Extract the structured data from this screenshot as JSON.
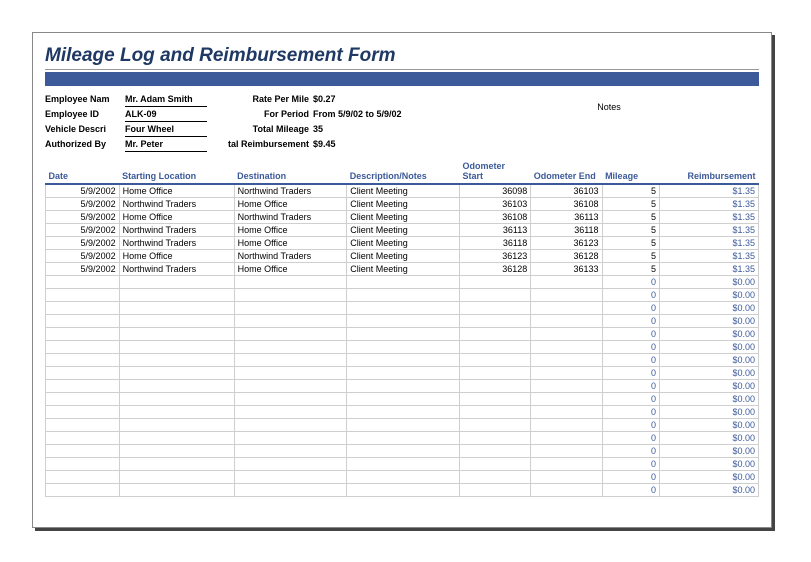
{
  "title": "Mileage Log and Reimbursement Form",
  "info": {
    "labels1": {
      "employee_name": "Employee Nam",
      "employee_id": "Employee ID",
      "vehicle_desc": "Vehicle Descri",
      "authorized_by": "Authorized By"
    },
    "values1": {
      "employee_name": "Mr. Adam Smith",
      "employee_id": "ALK-09",
      "vehicle_desc": "Four Wheel",
      "authorized_by": "Mr. Peter"
    },
    "labels2": {
      "rate": "Rate Per Mile",
      "period": "For Period",
      "total_mileage": "Total Mileage",
      "total_reimb": "tal Reimbursement"
    },
    "values2": {
      "rate": "$0.27",
      "period": "From 5/9/02 to 5/9/02",
      "total_mileage": "35",
      "total_reimb": "$9.45"
    },
    "notes_label": "Notes"
  },
  "columns": {
    "date": "Date",
    "start": "Starting Location",
    "dest": "Destination",
    "desc": "Description/Notes",
    "ostart": "Odometer Start",
    "oend": "Odometer End",
    "mileage": "Mileage",
    "reimb": "Reimbursement"
  },
  "rows": [
    {
      "date": "5/9/2002",
      "start": "Home Office",
      "dest": "Northwind Traders",
      "desc": "Client Meeting",
      "ostart": "36098",
      "oend": "36103",
      "mileage": "5",
      "reimb": "$1.35"
    },
    {
      "date": "5/9/2002",
      "start": "Northwind Traders",
      "dest": "Home Office",
      "desc": "Client Meeting",
      "ostart": "36103",
      "oend": "36108",
      "mileage": "5",
      "reimb": "$1.35"
    },
    {
      "date": "5/9/2002",
      "start": "Home Office",
      "dest": "Northwind Traders",
      "desc": "Client Meeting",
      "ostart": "36108",
      "oend": "36113",
      "mileage": "5",
      "reimb": "$1.35"
    },
    {
      "date": "5/9/2002",
      "start": "Northwind Traders",
      "dest": "Home Office",
      "desc": "Client Meeting",
      "ostart": "36113",
      "oend": "36118",
      "mileage": "5",
      "reimb": "$1.35"
    },
    {
      "date": "5/9/2002",
      "start": "Northwind Traders",
      "dest": "Home Office",
      "desc": "Client Meeting",
      "ostart": "36118",
      "oend": "36123",
      "mileage": "5",
      "reimb": "$1.35"
    },
    {
      "date": "5/9/2002",
      "start": "Home Office",
      "dest": "Northwind Traders",
      "desc": "Client Meeting",
      "ostart": "36123",
      "oend": "36128",
      "mileage": "5",
      "reimb": "$1.35"
    },
    {
      "date": "5/9/2002",
      "start": "Northwind Traders",
      "dest": "Home Office",
      "desc": "Client Meeting",
      "ostart": "36128",
      "oend": "36133",
      "mileage": "5",
      "reimb": "$1.35"
    }
  ],
  "empty_row": {
    "mileage": "0",
    "reimb": "$0.00"
  },
  "empty_count": 17
}
